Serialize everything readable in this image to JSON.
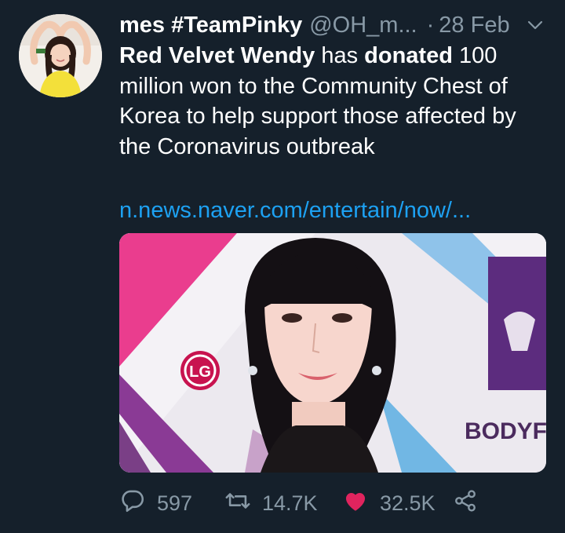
{
  "tweet": {
    "display_name": "mes #TeamPinky",
    "handle": "@OH_m...",
    "dot": "·",
    "date": "28 Feb",
    "text": {
      "part1": "Red Velvet Wendy",
      "part2": " has ",
      "part3": "donated",
      "part4": " 100 million won to the Community Chest of Korea to help support those affected by the Coronavirus outbreak"
    },
    "link": "n.news.naver.com/entertain/now/...",
    "media": {
      "logo_letters": "LG",
      "sign_text": "BODYFR"
    },
    "actions": {
      "reply_count": "597",
      "retweet_count": "14.7K",
      "like_count": "32.5K"
    }
  },
  "icons": {
    "reply": "reply-icon",
    "retweet": "retweet-icon",
    "like": "heart-icon",
    "share": "share-icon",
    "caret": "chevron-down-icon"
  },
  "colors": {
    "background": "#15202b",
    "text": "#ffffff",
    "secondary": "#8899a6",
    "link": "#1da1f2",
    "like": "#e0245e"
  }
}
